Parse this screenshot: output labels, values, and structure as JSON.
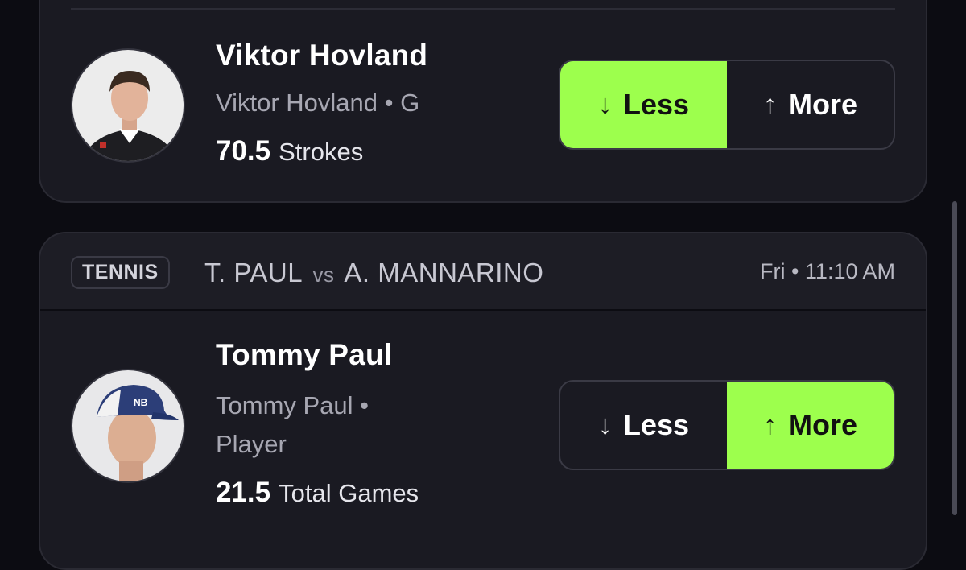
{
  "card1": {
    "player": {
      "name": "Viktor Hovland",
      "subtitle": "Viktor Hovland • G",
      "line": "70.5",
      "stat": "Strokes"
    },
    "toggle": {
      "less_label": "Less",
      "more_label": "More",
      "selected": "Less"
    }
  },
  "card2": {
    "header": {
      "sport": "TENNIS",
      "team1": "T. PAUL",
      "vs": "vs",
      "team2": "A. MANNARINO",
      "time": "Fri • 11:10 AM"
    },
    "player": {
      "name": "Tommy Paul",
      "subtitle_line1": "Tommy Paul •",
      "subtitle_line2": "Player",
      "line": "21.5",
      "stat": "Total Games"
    },
    "toggle": {
      "less_label": "Less",
      "more_label": "More",
      "selected": "More"
    }
  },
  "colors": {
    "accent": "#9dff4d",
    "card_bg": "#1a1a22",
    "page_bg": "#0c0c12"
  },
  "icons": {
    "less": "arrow-down-icon",
    "more": "arrow-up-icon"
  }
}
